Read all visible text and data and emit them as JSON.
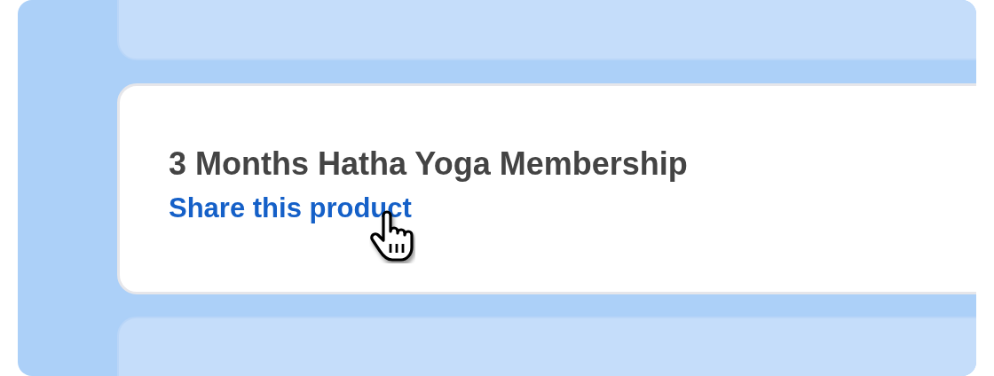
{
  "product_card": {
    "title": "3 Months Hatha Yoga Membership",
    "share_link": "Share this product"
  }
}
